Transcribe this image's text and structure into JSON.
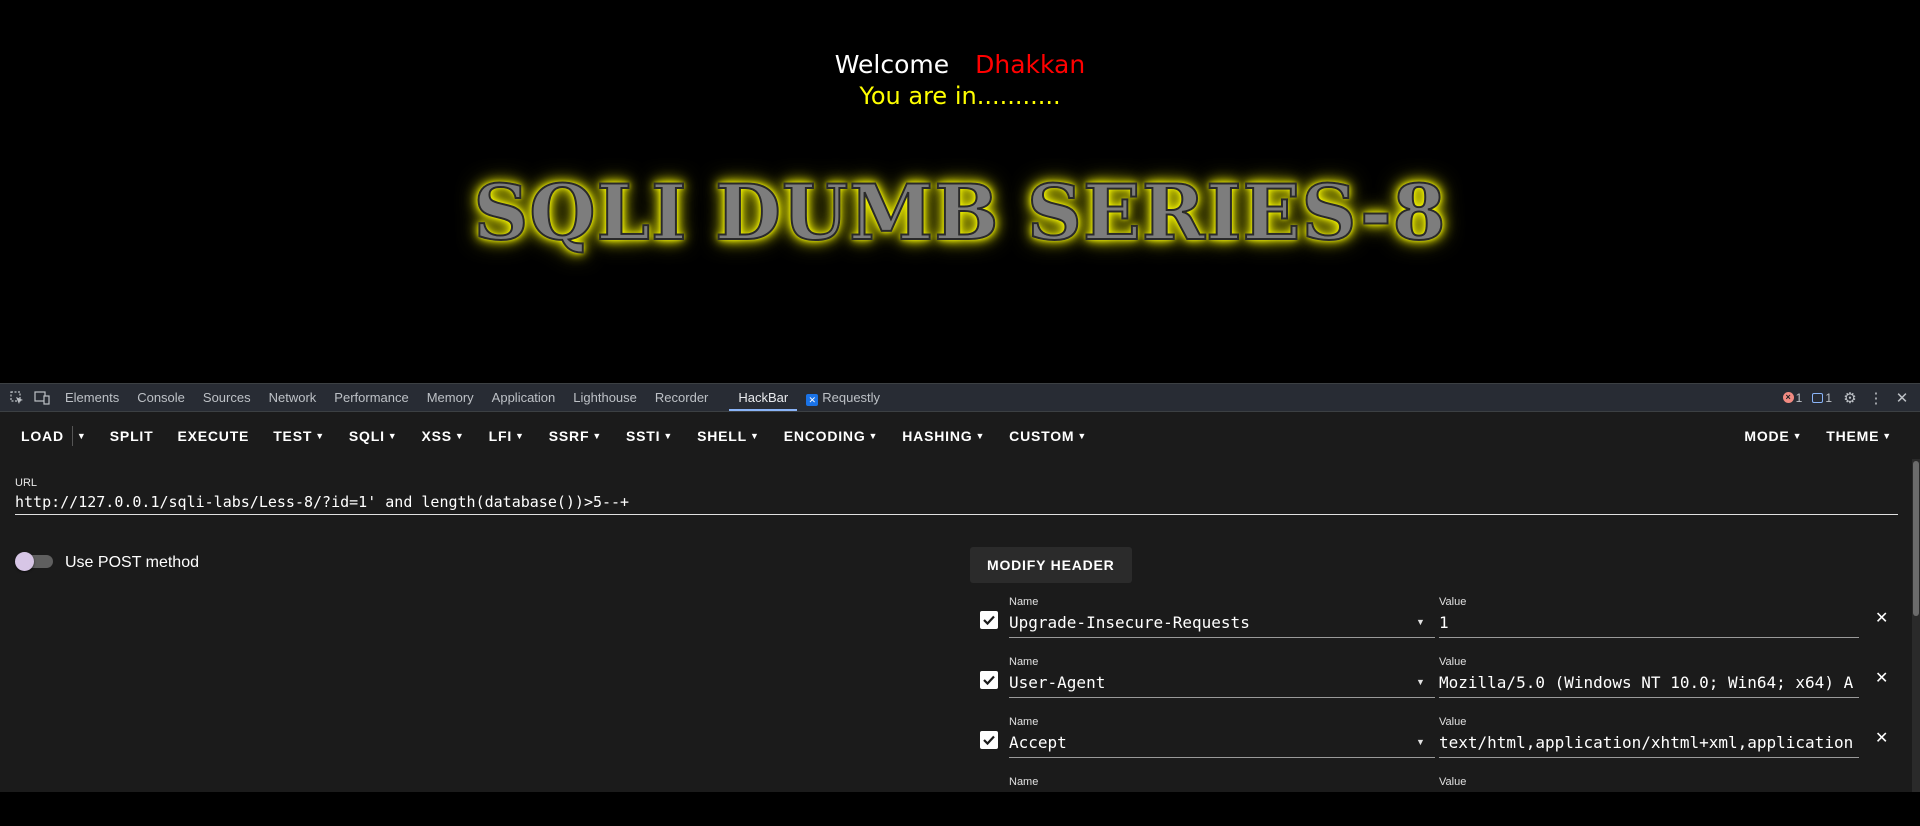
{
  "page": {
    "welcome": "Welcome",
    "name": "Dhakkan",
    "status": "You are in...........",
    "banner": "SQLI DUMB SERIES-8"
  },
  "devtools": {
    "tabs": [
      "Elements",
      "Console",
      "Sources",
      "Network",
      "Performance",
      "Memory",
      "Application",
      "Lighthouse",
      "Recorder",
      "HackBar",
      "Requestly"
    ],
    "active_tab": "HackBar",
    "error_count": "1",
    "message_count": "1"
  },
  "hackbar": {
    "toolbar": {
      "load": "LOAD",
      "split": "SPLIT",
      "execute": "EXECUTE",
      "test": "TEST",
      "sqli": "SQLI",
      "xss": "XSS",
      "lfi": "LFI",
      "ssrf": "SSRF",
      "ssti": "SSTI",
      "shell": "SHELL",
      "encoding": "ENCODING",
      "hashing": "HASHING",
      "custom": "CUSTOM",
      "mode": "MODE",
      "theme": "THEME"
    },
    "url_label": "URL",
    "url": "http://127.0.0.1/sqli-labs/Less-8/?id=1' and length(database())>5--+",
    "post_label": "Use POST method",
    "post_enabled": false,
    "modify_header_label": "MODIFY HEADER",
    "headers": [
      {
        "name_label": "Name",
        "name": "Upgrade-Insecure-Requests",
        "value_label": "Value",
        "value": "1",
        "checked": true
      },
      {
        "name_label": "Name",
        "name": "User-Agent",
        "value_label": "Value",
        "value": "Mozilla/5.0 (Windows NT 10.0; Win64; x64) A",
        "checked": true
      },
      {
        "name_label": "Name",
        "name": "Accept",
        "value_label": "Value",
        "value": "text/html,application/xhtml+xml,application",
        "checked": true
      },
      {
        "name_label": "Name",
        "name": "",
        "value_label": "Value",
        "value": "",
        "checked": false
      }
    ]
  },
  "colors": {
    "welcome": "#ffffff",
    "name": "#ff0000",
    "status": "#ffff00",
    "banner_glow": "#ffff00",
    "active_tab_indicator": "#8ab4f8"
  }
}
